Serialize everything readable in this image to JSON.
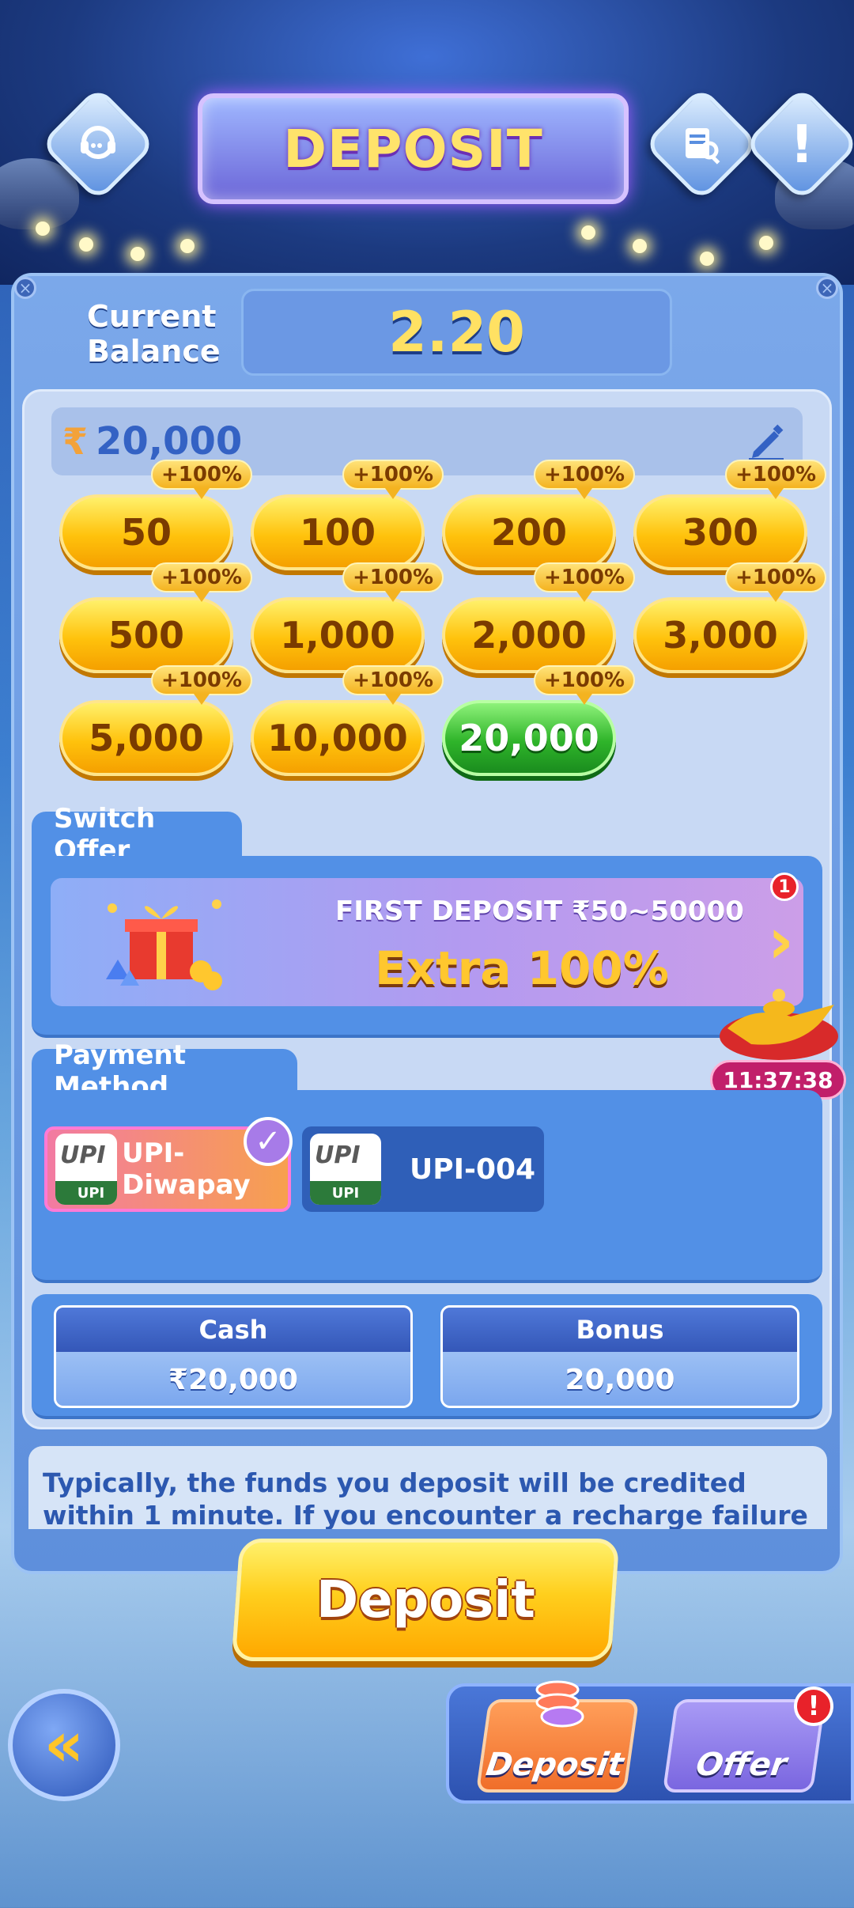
{
  "header": {
    "title": "DEPOSIT",
    "support_icon": "headset-chat-icon",
    "records_icon": "records-search-icon",
    "info_icon": "exclamation-icon"
  },
  "balance": {
    "label_line1": "Current",
    "label_line2": "Balance",
    "value": "2.20"
  },
  "amount_input": {
    "currency_symbol": "₹",
    "value": "20,000",
    "edit_icon": "pencil-icon"
  },
  "amounts": [
    {
      "label": "50",
      "tag": "+100%",
      "selected": false
    },
    {
      "label": "100",
      "tag": "+100%",
      "selected": false
    },
    {
      "label": "200",
      "tag": "+100%",
      "selected": false
    },
    {
      "label": "300",
      "tag": "+100%",
      "selected": false
    },
    {
      "label": "500",
      "tag": "+100%",
      "selected": false
    },
    {
      "label": "1,000",
      "tag": "+100%",
      "selected": false
    },
    {
      "label": "2,000",
      "tag": "+100%",
      "selected": false
    },
    {
      "label": "3,000",
      "tag": "+100%",
      "selected": false
    },
    {
      "label": "5,000",
      "tag": "+100%",
      "selected": false
    },
    {
      "label": "10,000",
      "tag": "+100%",
      "selected": false
    },
    {
      "label": "20,000",
      "tag": "+100%",
      "selected": true
    }
  ],
  "offer": {
    "section_label": "Switch Offer",
    "title": "FIRST DEPOSIT ₹50~50000",
    "headline": "Extra 100%",
    "badge_count": "1",
    "timer": "11:37:38"
  },
  "payment": {
    "section_label": "Payment Method",
    "methods": [
      {
        "name": "UPI-Diwapay",
        "logo_text": "UPI",
        "logo_sub": "UPI",
        "selected": true
      },
      {
        "name": "UPI-004",
        "logo_text": "UPI",
        "logo_sub": "UPI",
        "selected": false
      }
    ]
  },
  "summary": {
    "cash_label": "Cash",
    "cash_value": "₹20,000",
    "bonus_label": "Bonus",
    "bonus_value": "20,000"
  },
  "info_text": "Typically, the funds you deposit will be credited within 1 minute. If you encounter a recharge failure due to channel fluctuations, we",
  "deposit_button": "Deposit",
  "bottom_nav": {
    "back_icon": "double-chevron-left-icon",
    "deposit_label": "Deposit",
    "offer_label": "Offer",
    "offer_alert": "!"
  }
}
